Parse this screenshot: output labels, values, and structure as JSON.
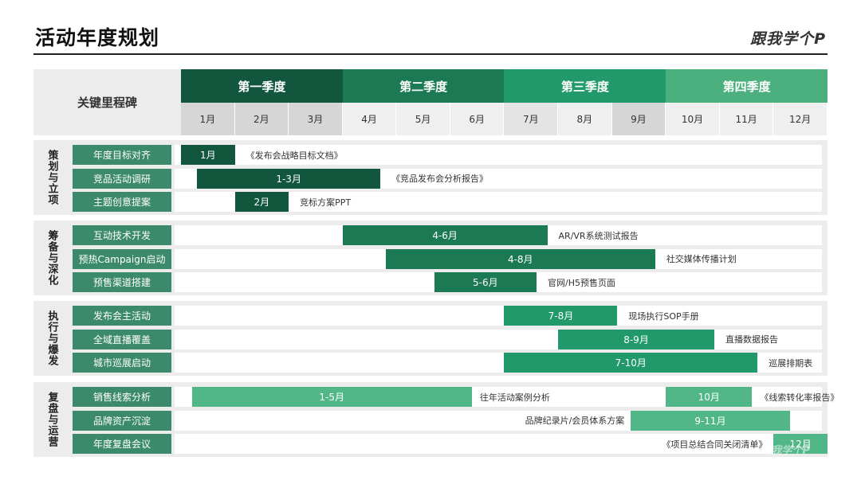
{
  "header": {
    "title": "活动年度规划",
    "brand": "跟我学个P"
  },
  "table": {
    "milestone_header": "关键里程碑",
    "quarters": [
      {
        "label": "第一季度",
        "color": "#11563d"
      },
      {
        "label": "第二季度",
        "color": "#1b7a53"
      },
      {
        "label": "第三季度",
        "color": "#22996a"
      },
      {
        "label": "第四季度",
        "color": "#4bb07d"
      }
    ],
    "months": [
      "1月",
      "2月",
      "3月",
      "4月",
      "5月",
      "6月",
      "7月",
      "8月",
      "9月",
      "10月",
      "11月",
      "12月"
    ],
    "groups": [
      {
        "name": "策划与立项",
        "tasks": [
          {
            "label": "年度目标对齐",
            "bar": {
              "text": "1月",
              "start": 1,
              "end": 1,
              "color": "#11563d"
            },
            "note": "《发布会战略目标文档》"
          },
          {
            "label": "竞品活动调研",
            "bar": {
              "text": "1-3月",
              "start": 1.3,
              "end": 3.7,
              "color": "#11563d"
            },
            "note": "《竞品发布会分析报告》"
          },
          {
            "label": "主题创意提案",
            "bar": {
              "text": "2月",
              "start": 2,
              "end": 2,
              "color": "#11563d"
            },
            "note": "竞标方案PPT"
          }
        ]
      },
      {
        "name": "筹备与深化",
        "tasks": [
          {
            "label": "互动技术开发",
            "bar": {
              "text": "4-6月",
              "start": 4,
              "end": 6.8,
              "color": "#1b7a53"
            },
            "note": "AR/VR系统测试报告"
          },
          {
            "label": "预热Campaign启动",
            "bar": {
              "text": "4-8月",
              "start": 4.8,
              "end": 8.8,
              "color": "#1b7a53"
            },
            "note": "社交媒体传播计划"
          },
          {
            "label": "预售渠道搭建",
            "bar": {
              "text": "5-6月",
              "start": 5.7,
              "end": 6.6,
              "color": "#1b7a53"
            },
            "note": "官网/H5预售页面"
          }
        ]
      },
      {
        "name": "执行与爆发",
        "tasks": [
          {
            "label": "发布会主活动",
            "bar": {
              "text": "7-8月",
              "start": 7,
              "end": 8.1,
              "color": "#22996a"
            },
            "note": "现场执行SOP手册"
          },
          {
            "label": "全域直播覆盖",
            "bar": {
              "text": "8-9月",
              "start": 8,
              "end": 9.9,
              "color": "#22996a"
            },
            "note": "直播数据报告"
          },
          {
            "label": "城市巡展启动",
            "bar": {
              "text": "7-10月",
              "start": 7,
              "end": 10.7,
              "color": "#22996a"
            },
            "note": "巡展排期表"
          }
        ]
      },
      {
        "name": "复盘与运营",
        "tasks": [
          {
            "label": "销售线索分析",
            "bar": {
              "text": "1-5月",
              "start": 1.2,
              "end": 5.4,
              "color": "#52b788"
            },
            "bar2": {
              "text": "10月",
              "start": 10,
              "end": 10.6,
              "color": "#52b788"
            },
            "note": "往年活动案例分析",
            "note2": "《线索转化率报告》"
          },
          {
            "label": "品牌资产沉淀",
            "bar": {
              "text": "9-11月",
              "start": 9.35,
              "end": 11.3,
              "color": "#52b788"
            },
            "note": "品牌纪录片/会员体系方案"
          },
          {
            "label": "年度复盘会议",
            "bar": {
              "text": "12月",
              "start": 12,
              "end": 12,
              "color": "#52b788"
            },
            "note": "《项目总结合同关闭清单》"
          }
        ]
      }
    ]
  },
  "watermark": "跟我学个P"
}
